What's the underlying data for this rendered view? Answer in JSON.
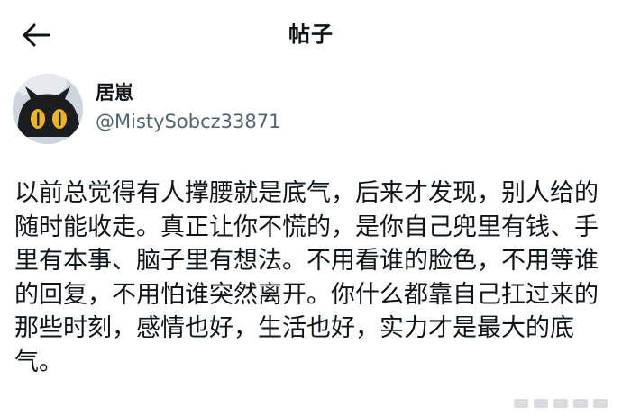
{
  "header": {
    "back_icon": "arrow-left-icon",
    "title": "帖子"
  },
  "author": {
    "avatar_icon": "cat-avatar-icon",
    "display_name": "居崽",
    "handle": "@MistySobcz33871"
  },
  "post": {
    "text": "以前总觉得有人撑腰就是底气，后来才发现，别人给的随时能收走。真正让你不慌的，是你自己兜里有钱、手里有本事、脑子里有想法。不用看谁的脸色，不用等谁的回复，不用怕谁突然离开。你什么都靠自己扛过来的那些时刻，感情也好，生活也好，实力才是最大的底气。"
  },
  "colors": {
    "text_primary": "#0f1419",
    "text_secondary": "#536471",
    "background": "#ffffff"
  }
}
